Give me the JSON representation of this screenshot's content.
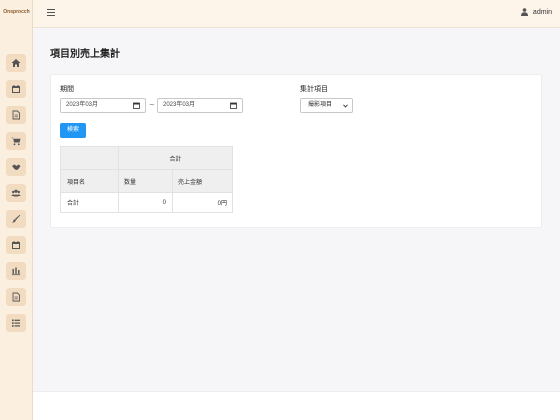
{
  "app": {
    "logo_text": "Onsprocch"
  },
  "header": {
    "user_name": "admin"
  },
  "sidebar": {
    "items": [
      {
        "icon": "home-icon"
      },
      {
        "icon": "calendar-icon"
      },
      {
        "icon": "document-icon"
      },
      {
        "icon": "cart-icon"
      },
      {
        "icon": "handshake-icon"
      },
      {
        "icon": "users-icon"
      },
      {
        "icon": "brush-icon"
      },
      {
        "icon": "calendar-icon"
      },
      {
        "icon": "chart-icon"
      },
      {
        "icon": "document-icon"
      },
      {
        "icon": "list-icon"
      }
    ]
  },
  "page": {
    "title": "項目別売上集計"
  },
  "filters": {
    "period_label": "期間",
    "date_from": "2023年03月",
    "separator": "~",
    "date_to": "2023年03月",
    "aggregation_label": "集計項目",
    "aggregation_value": "撮影項目",
    "search_label": "検索"
  },
  "table": {
    "group_header": "合計",
    "headers": [
      "項目名",
      "数量",
      "売上金額"
    ],
    "rows": [
      [
        "合計",
        "0",
        "0円"
      ]
    ]
  }
}
